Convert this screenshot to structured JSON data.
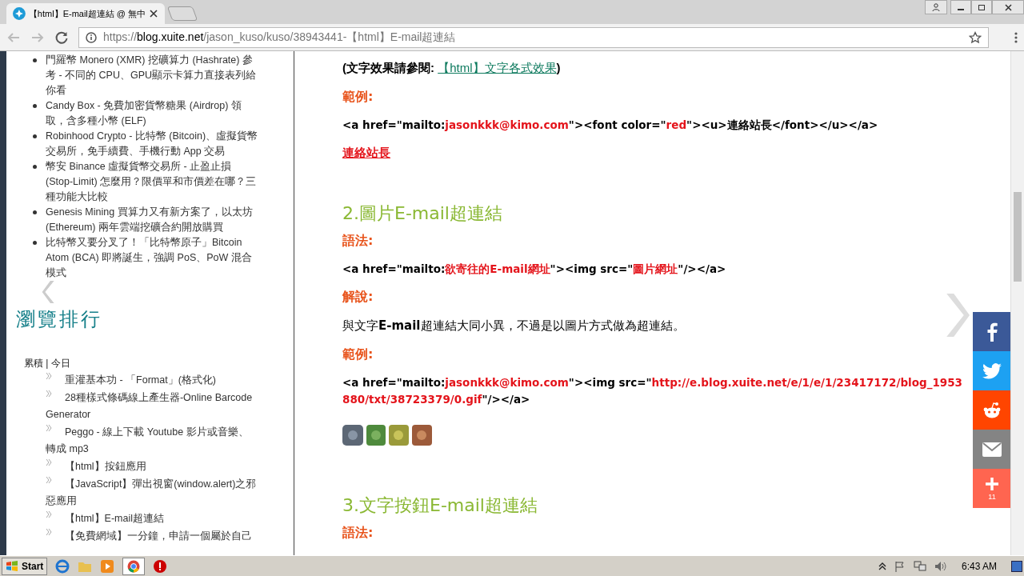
{
  "browser": {
    "tab_title": "【html】E-mail超連結 @ 無中",
    "url_host": "blog.xuite.net",
    "url_scheme": "https://",
    "url_path": "/jason_kuso/kuso/38943441-【html】E-mail超連結"
  },
  "sidebar": {
    "recent_posts": [
      "門羅幣 Monero (XMR) 挖礦算力 (Hashrate) 參考 - 不同的 CPU、GPU顯示卡算力直接表列給你看",
      "Candy Box - 免費加密貨幣糖果 (Airdrop) 領取，含多種小幣 (ELF)",
      "Robinhood Crypto - 比特幣 (Bitcoin)、虛擬貨幣交易所，免手續費、手機行動 App 交易",
      "幣安 Binance 虛擬貨幣交易所 - 止盈止損 (Stop-Limit) 怎麼用？限價單和市價差在哪？三種功能大比較",
      "Genesis Mining 買算力又有新方案了，以太坊 (Ethereum) 兩年雲端挖礦合約開放購買",
      "比特幣又要分叉了！「比特幣原子」Bitcoin Atom (BCA) 即將誕生，強調 PoS、PoW 混合模式"
    ],
    "ranking_title": "瀏覽排行",
    "ranking_tabs": "累積 | 今日",
    "ranking": [
      "重灌基本功 - 「Format」(格式化)",
      "28種樣式條碼線上產生器-Online Barcode Generator",
      "Peggo - 線上下載 Youtube 影片或音樂、轉成 mp3",
      "【html】按鈕應用",
      "【JavaScript】彈出視窗(window.alert)之邪惡應用",
      "【html】E-mail超連結",
      "【免費網域】一分鐘，申請一個屬於自己"
    ]
  },
  "article": [
    {
      "kind": "reference",
      "parts": [
        {
          "kind": "plain",
          "text": "(文字效果請參閱: "
        },
        {
          "kind": "link",
          "text": "【html】文字各式效果"
        },
        {
          "kind": "plain",
          "text": ")"
        }
      ]
    },
    {
      "kind": "label",
      "text": "範例:"
    },
    {
      "kind": "code",
      "parts": [
        {
          "kind": "plain",
          "text": "<a href=\"mailto:"
        },
        {
          "kind": "value",
          "text": "jasonkkk@kimo.com"
        },
        {
          "kind": "plain",
          "text": "\"><font color=\""
        },
        {
          "kind": "value",
          "text": "red"
        },
        {
          "kind": "plain",
          "text": "\"><u>連絡站長</font></u></a>"
        }
      ]
    },
    {
      "kind": "demo_link",
      "text": "連絡站長"
    },
    {
      "kind": "heading",
      "text": "2.圖片E-mail超連結"
    },
    {
      "kind": "label",
      "text": "語法:"
    },
    {
      "kind": "code",
      "parts": [
        {
          "kind": "plain",
          "text": "<a href=\"mailto:"
        },
        {
          "kind": "value",
          "text": "欲寄往的E-mail網址"
        },
        {
          "kind": "plain",
          "text": "\"><img src=\""
        },
        {
          "kind": "value",
          "text": "圖片網址"
        },
        {
          "kind": "plain",
          "text": "\"/></a>"
        }
      ]
    },
    {
      "kind": "label",
      "text": "解說:"
    },
    {
      "kind": "text",
      "text": "與文字**E-mail**超連結大同小異，不過是以圖片方式做為超連結。"
    },
    {
      "kind": "label",
      "text": "範例:"
    },
    {
      "kind": "code",
      "parts": [
        {
          "kind": "plain",
          "text": "<a href=\"mailto:"
        },
        {
          "kind": "value",
          "text": "jasonkkk@kimo.com"
        },
        {
          "kind": "plain",
          "text": "\"><img src=\""
        },
        {
          "kind": "value",
          "text": "http://e.blog.xuite.net/e/1/e/1/23417172/blog_1953880/txt/38723379/0.gif"
        },
        {
          "kind": "plain",
          "text": "\"/></a>"
        }
      ]
    },
    {
      "kind": "picture"
    },
    {
      "kind": "heading",
      "text": "3.文字按鈕E-mail超連結"
    },
    {
      "kind": "label",
      "text": "語法:"
    }
  ],
  "share": [
    {
      "kind": "facebook"
    },
    {
      "kind": "twitter"
    },
    {
      "kind": "reddit"
    },
    {
      "kind": "email"
    },
    {
      "kind": "more",
      "count": "11"
    }
  ],
  "taskbar": {
    "start": "Start",
    "clock": "6:43 AM"
  }
}
